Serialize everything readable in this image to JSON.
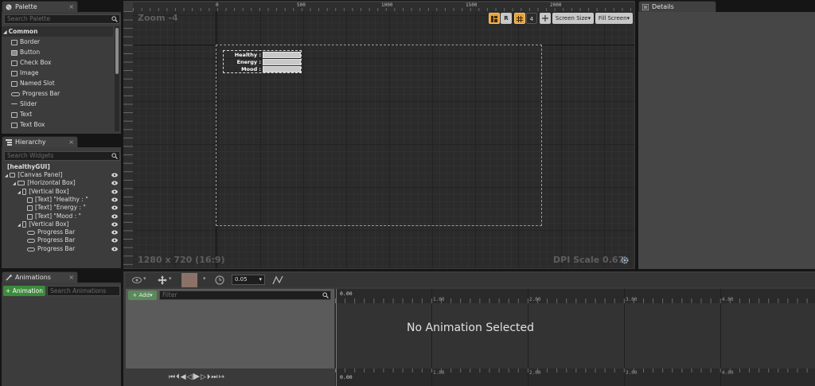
{
  "palette": {
    "tab": "Palette",
    "search_placeholder": "Search Palette",
    "category": "Common",
    "items": [
      {
        "label": "Border",
        "icon": "border-icon"
      },
      {
        "label": "Button",
        "icon": "button-icon"
      },
      {
        "label": "Check Box",
        "icon": "checkbox-icon"
      },
      {
        "label": "Image",
        "icon": "image-icon"
      },
      {
        "label": "Named Slot",
        "icon": "named-slot-icon"
      },
      {
        "label": "Progress Bar",
        "icon": "progress-bar-icon"
      },
      {
        "label": "Slider",
        "icon": "slider-icon"
      },
      {
        "label": "Text",
        "icon": "text-icon"
      },
      {
        "label": "Text Box",
        "icon": "text-box-icon"
      }
    ]
  },
  "hierarchy": {
    "tab": "Hierarchy",
    "search_placeholder": "Search Widgets",
    "root": "[healthyGUI]",
    "items": [
      {
        "label": "[Canvas Panel]"
      },
      {
        "label": "[Horizontal Box]"
      },
      {
        "label": "[Vertical Box]"
      },
      {
        "label": "[Text] \"Healthy : \""
      },
      {
        "label": "[Text] \"Energy : \""
      },
      {
        "label": "[Text] \"Mood : \""
      },
      {
        "label": "[Vertical Box]"
      },
      {
        "label": "Progress Bar"
      },
      {
        "label": "Progress Bar"
      },
      {
        "label": "Progress Bar"
      }
    ]
  },
  "designer": {
    "zoom": "Zoom -4",
    "resolution": "1280 x 720 (16:9)",
    "dpi": "DPI Scale 0.67",
    "ruler_ticks": [
      "0",
      "500",
      "1000",
      "1500",
      "2000"
    ],
    "toolbar": {
      "r_label": "R",
      "step": "4",
      "screen_size": "Screen Size",
      "fill_screen": "Fill Screen"
    },
    "widget": {
      "labels": [
        "Healthy :",
        "Energy :",
        "Mood :"
      ],
      "bar_percents": [
        0,
        0,
        0
      ]
    }
  },
  "details": {
    "tab": "Details"
  },
  "animations": {
    "tab": "Animations",
    "add_button": "+ Animation",
    "search_placeholder": "Search Animations"
  },
  "timeline": {
    "snap_value": "0.05",
    "add_label": "+ Add",
    "filter_placeholder": "Filter",
    "empty_message": "No Animation Selected",
    "ticks": [
      "0.00",
      "1.00",
      "2.00",
      "3.00",
      "4.00"
    ]
  },
  "colors": {
    "accent": "#e8a23a",
    "add_green": "#3d8a3d"
  }
}
